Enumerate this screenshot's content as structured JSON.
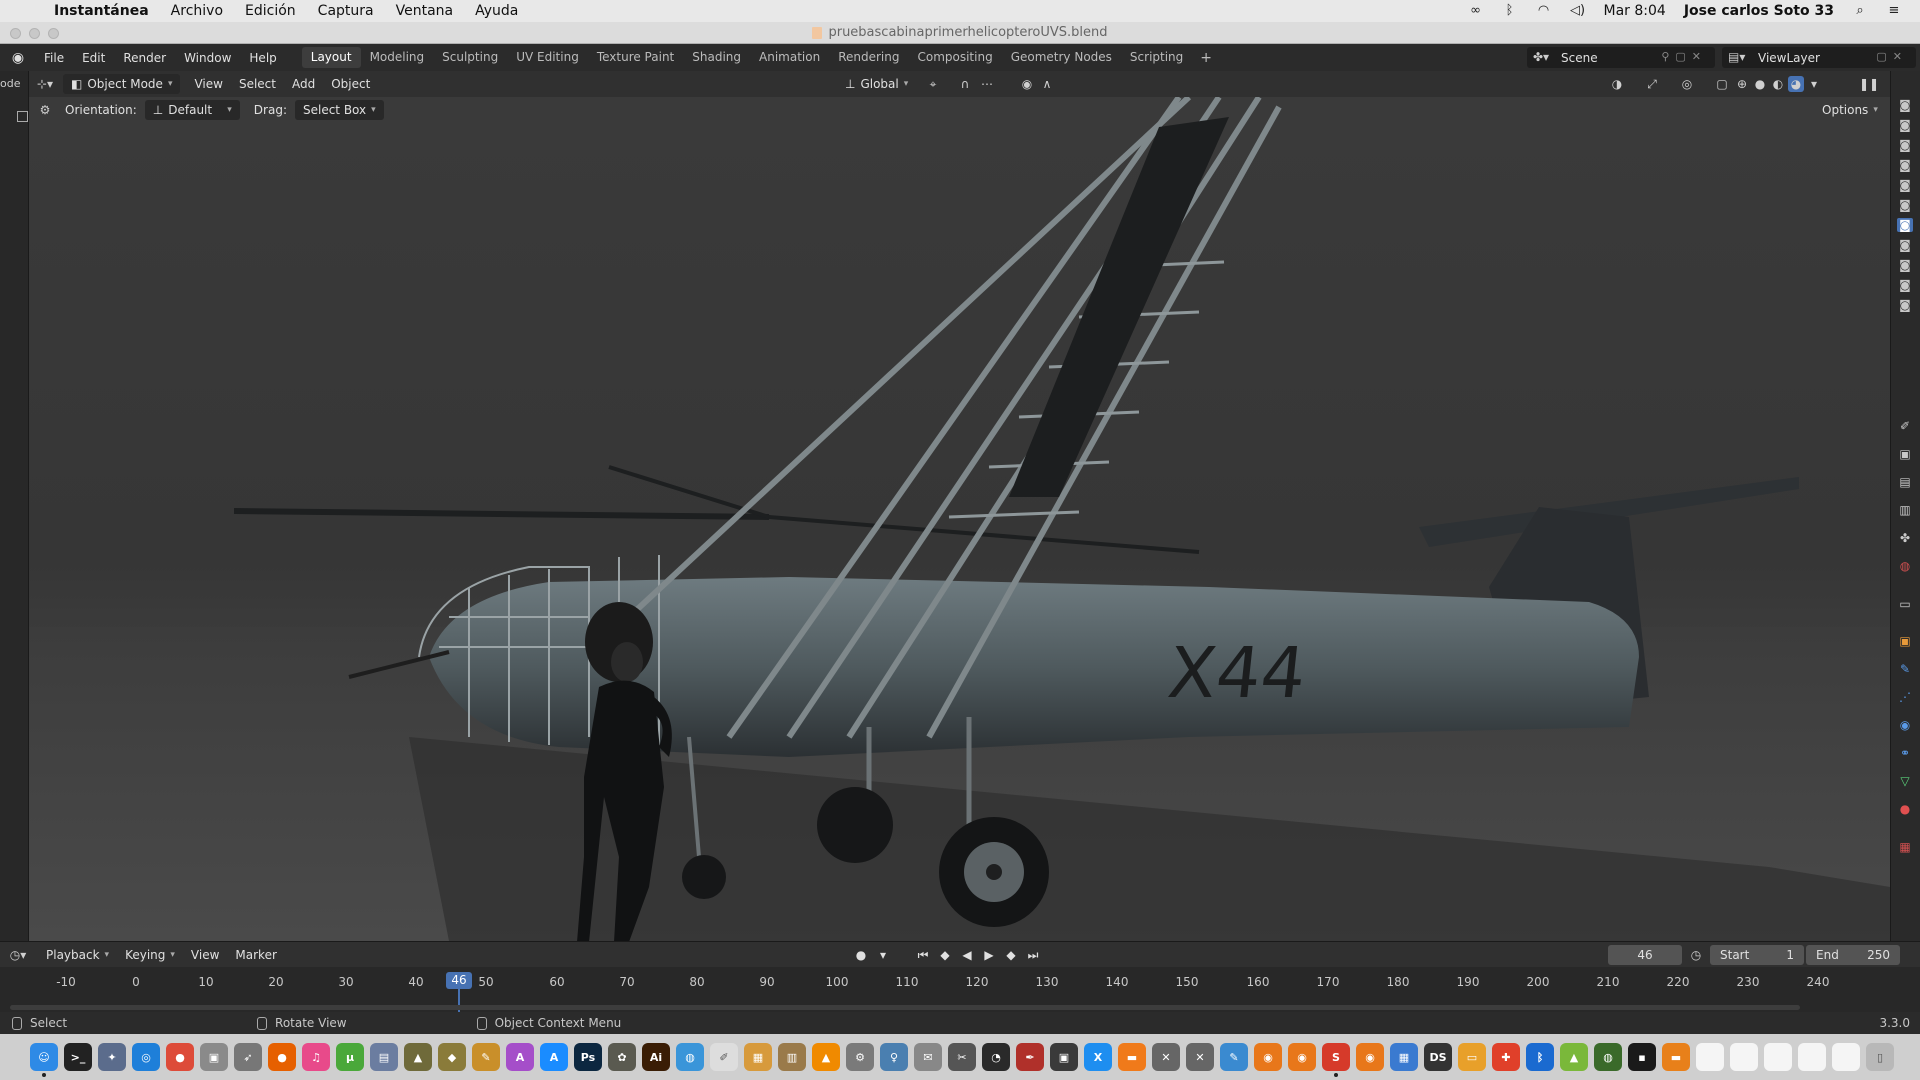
{
  "mac_menubar": {
    "app_name": "Instantánea",
    "menus": [
      "Archivo",
      "Edición",
      "Captura",
      "Ventana",
      "Ayuda"
    ],
    "clock": "Mar 8:04",
    "user": "Jose carlos Soto 33"
  },
  "window": {
    "title": "pruebascabinaprimerhelicopteroUVS.blend"
  },
  "blender_topbar": {
    "menus": [
      "File",
      "Edit",
      "Render",
      "Window",
      "Help"
    ],
    "workspaces": [
      {
        "label": "Layout",
        "active": true
      },
      {
        "label": "Modeling",
        "active": false
      },
      {
        "label": "Sculpting",
        "active": false
      },
      {
        "label": "UV Editing",
        "active": false
      },
      {
        "label": "Texture Paint",
        "active": false
      },
      {
        "label": "Shading",
        "active": false
      },
      {
        "label": "Animation",
        "active": false
      },
      {
        "label": "Rendering",
        "active": false
      },
      {
        "label": "Compositing",
        "active": false
      },
      {
        "label": "Geometry Nodes",
        "active": false
      },
      {
        "label": "Scripting",
        "active": false
      }
    ],
    "add_workspace": "+",
    "scene": "Scene",
    "view_layer": "ViewLayer"
  },
  "left_strip": {
    "mode_label": "ode"
  },
  "viewport_header": {
    "mode": "Object Mode",
    "menus": [
      "View",
      "Select",
      "Add",
      "Object"
    ],
    "transform_orientation": "Global",
    "options": "Options"
  },
  "tool_settings": {
    "orientation_label": "Orientation:",
    "orientation_value": "Default",
    "drag_label": "Drag:",
    "drag_value": "Select Box"
  },
  "model_decal": "X44",
  "timeline": {
    "menus": [
      "Playback",
      "Keying",
      "View",
      "Marker"
    ],
    "current_frame": "46",
    "start_label": "Start",
    "start_value": "1",
    "end_label": "End",
    "end_value": "250",
    "ruler_ticks": [
      "-10",
      "0",
      "10",
      "20",
      "30",
      "40",
      "50",
      "60",
      "70",
      "80",
      "90",
      "100",
      "110",
      "120",
      "130",
      "140",
      "150",
      "160",
      "170",
      "180",
      "190",
      "200",
      "210",
      "220",
      "230",
      "240"
    ],
    "cursor_label": "46"
  },
  "statusbar": {
    "select": "Select",
    "rotate_view": "Rotate View",
    "context_menu": "Object Context Menu",
    "version": "3.3.0"
  },
  "dock": {
    "apps": [
      {
        "name": "Finder",
        "label": "☺",
        "color": "#2e8ae6"
      },
      {
        "name": "Terminal",
        "label": ">_",
        "color": "#222222"
      },
      {
        "name": "Launchpad",
        "label": "✦",
        "color": "#5b6c8c"
      },
      {
        "name": "Safari",
        "label": "◎",
        "color": "#1e7fd9"
      },
      {
        "name": "Chrome",
        "label": "●",
        "color": "#dd4b39"
      },
      {
        "name": "Preview",
        "label": "▣",
        "color": "#8a8a8a"
      },
      {
        "name": "Rocket",
        "label": "➶",
        "color": "#777777"
      },
      {
        "name": "Firefox",
        "label": "●",
        "color": "#e66000"
      },
      {
        "name": "iTunes",
        "label": "♫",
        "color": "#e84a8a"
      },
      {
        "name": "uTorrent",
        "label": "µ",
        "color": "#4aa83a"
      },
      {
        "name": "Scanner",
        "label": "▤",
        "color": "#6b7da0"
      },
      {
        "name": "Game1",
        "label": "▲",
        "color": "#6f6a3a"
      },
      {
        "name": "Game2",
        "label": "◆",
        "color": "#8a7b3a"
      },
      {
        "name": "Sketch",
        "label": "✎",
        "color": "#c98f2a"
      },
      {
        "name": "Affinity",
        "label": "A",
        "color": "#a54ec9"
      },
      {
        "name": "AppStore",
        "label": "A",
        "color": "#1a8cff"
      },
      {
        "name": "Photoshop",
        "label": "Ps",
        "color": "#0c2740"
      },
      {
        "name": "Gimp",
        "label": "✿",
        "color": "#5a5a50"
      },
      {
        "name": "Illustrator",
        "label": "Ai",
        "color": "#3a1d05"
      },
      {
        "name": "Globe",
        "label": "◍",
        "color": "#3a95d9"
      },
      {
        "name": "TextEdit",
        "label": "✐",
        "color": "#dddddd"
      },
      {
        "name": "Folder",
        "label": "▦",
        "color": "#d79a3c"
      },
      {
        "name": "Archive",
        "label": "▥",
        "color": "#9a7a4a"
      },
      {
        "name": "VLC",
        "label": "▲",
        "color": "#f08a00"
      },
      {
        "name": "Settings",
        "label": "⚙",
        "color": "#7a7a7a"
      },
      {
        "name": "Figure",
        "label": "♀",
        "color": "#4a7fb0"
      },
      {
        "name": "Stamp",
        "label": "✉",
        "color": "#888888"
      },
      {
        "name": "Tool",
        "label": "✂",
        "color": "#555555"
      },
      {
        "name": "Search",
        "label": "◔",
        "color": "#2a2a2a"
      },
      {
        "name": "Pen",
        "label": "✒",
        "color": "#b0302a"
      },
      {
        "name": "Photo",
        "label": "▣",
        "color": "#3a3a3a"
      },
      {
        "name": "Xcode",
        "label": "X",
        "color": "#1e8ef0"
      },
      {
        "name": "Books",
        "label": "▬",
        "color": "#f07a1a"
      },
      {
        "name": "Figure2",
        "label": "✕",
        "color": "#666666"
      },
      {
        "name": "Figure3",
        "label": "✕",
        "color": "#666666"
      },
      {
        "name": "Brush",
        "label": "✎",
        "color": "#3a8ad0"
      },
      {
        "name": "Blender1",
        "label": "◉",
        "color": "#e8771a"
      },
      {
        "name": "Blender2",
        "label": "◉",
        "color": "#e8771a"
      },
      {
        "name": "Substance",
        "label": "S",
        "color": "#d63a2a"
      },
      {
        "name": "Blender3",
        "label": "◉",
        "color": "#e8771a"
      },
      {
        "name": "Grid",
        "label": "▦",
        "color": "#3a7ad0"
      },
      {
        "name": "DAZ",
        "label": "DS",
        "color": "#333333"
      },
      {
        "name": "Notes",
        "label": "▭",
        "color": "#e8a02a"
      },
      {
        "name": "Puzzle",
        "label": "✚",
        "color": "#e0402a"
      },
      {
        "name": "Bluetooth",
        "label": "ᛒ",
        "color": "#1a6ad0"
      },
      {
        "name": "Android",
        "label": "▲",
        "color": "#7ab83a"
      },
      {
        "name": "Globe2",
        "label": "◍",
        "color": "#3a6a2a"
      },
      {
        "name": "Screen",
        "label": "▪",
        "color": "#1a1a1a"
      },
      {
        "name": "Slides",
        "label": "▬",
        "color": "#e8801a"
      },
      {
        "name": "Doc1",
        "label": "",
        "color": "#f5f5f5"
      },
      {
        "name": "Doc2",
        "label": "",
        "color": "#f5f5f5"
      },
      {
        "name": "Doc3",
        "label": "",
        "color": "#f5f5f5"
      },
      {
        "name": "Doc4",
        "label": "",
        "color": "#f5f5f5"
      },
      {
        "name": "Doc5",
        "label": "",
        "color": "#f5f5f5"
      },
      {
        "name": "Trash",
        "label": "▯",
        "color": "#b8b8b8"
      }
    ]
  },
  "colors": {
    "accent": "#4772b3",
    "panel": "#303030",
    "header": "#2b2b2b"
  }
}
